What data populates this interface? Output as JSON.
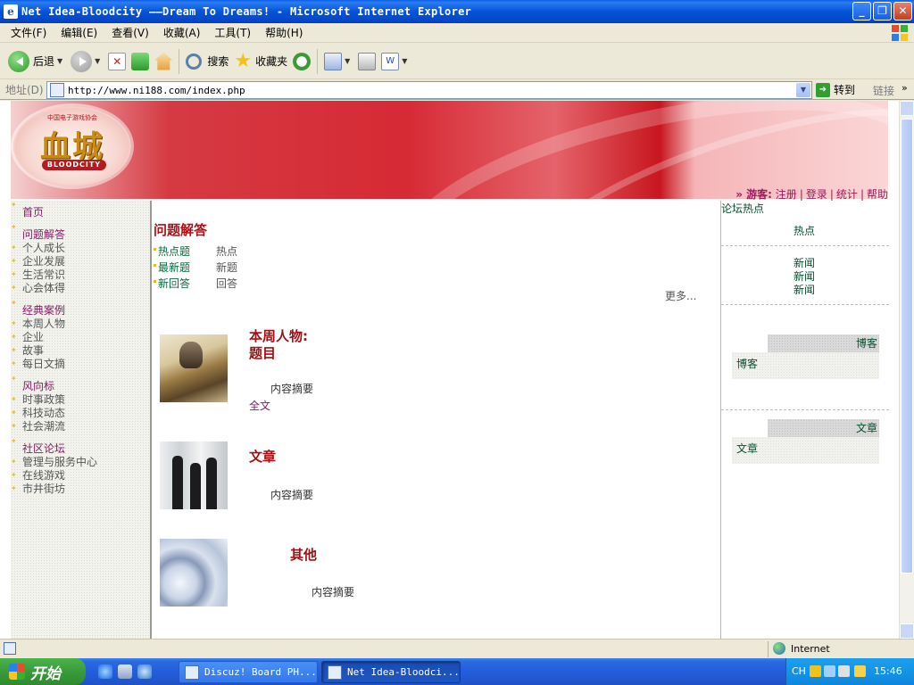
{
  "window": {
    "title": "Net Idea-Bloodcity ——Dream To Dreams! - Microsoft Internet Explorer",
    "controls": [
      "minimize-icon",
      "restore-icon",
      "close-icon"
    ]
  },
  "menubar": {
    "items": [
      "文件(F)",
      "编辑(E)",
      "查看(V)",
      "收藏(A)",
      "工具(T)",
      "帮助(H)"
    ]
  },
  "toolbar": {
    "back_label": "后退",
    "search_label": "搜索",
    "favorites_label": "收藏夹"
  },
  "address": {
    "label": "地址(D)",
    "url": "http://www.ni188.com/index.php",
    "go_label": "转到",
    "links_label": "链接"
  },
  "page": {
    "logo": {
      "org_text": "中国电子游戏协会",
      "cn_text": "血城",
      "en_text": "BLOODCITY"
    },
    "usernav": {
      "guest_label": "» 游客:",
      "links": [
        "注册",
        "登录",
        "统计",
        "帮助"
      ]
    },
    "left_nav": [
      {
        "heading": "首页",
        "items": []
      },
      {
        "heading": "问题解答",
        "items": [
          "个人成长",
          "企业发展",
          "生活常识",
          "心会体得"
        ]
      },
      {
        "heading": "经典案例",
        "items": [
          "本周人物",
          "企业",
          "故事",
          "每日文摘"
        ]
      },
      {
        "heading": "风向标",
        "items": [
          "时事政策",
          "科技动态",
          "社会潮流"
        ]
      },
      {
        "heading": "社区论坛",
        "items": [
          "管理与服务中心",
          "在线游戏",
          "市井街坊"
        ]
      }
    ],
    "qa": {
      "title": "问题解答",
      "rows": [
        {
          "label": "热点题",
          "value": "热点"
        },
        {
          "label": "最新题",
          "value": "新题"
        },
        {
          "label": "新回答",
          "value": "回答"
        }
      ],
      "more_label": "更多..."
    },
    "features": [
      {
        "title_line1": "本周人物:",
        "title_line2": "题目",
        "summary": "内容摘要",
        "link": "全文",
        "image": "warrior-photo"
      },
      {
        "title_line1": "文章",
        "summary": "内容摘要",
        "image": "business-people-photo"
      },
      {
        "title_line1": "其他",
        "summary": "内容摘要",
        "image": "abstract-swirl-photo"
      }
    ],
    "right": {
      "title": "论坛热点",
      "hot_label": "热点",
      "news": [
        "新闻",
        "新闻",
        "新闻"
      ],
      "blog_box": {
        "header": "博客",
        "body": "博客"
      },
      "article_box": {
        "header": "文章",
        "body": "文章"
      }
    }
  },
  "statusbar": {
    "zone": "Internet"
  },
  "taskbar": {
    "start_label": "开始",
    "tasks": [
      {
        "label": "Discuz! Board PH...",
        "active": false
      },
      {
        "label": "Net Idea-Bloodci...",
        "active": true
      }
    ],
    "tray_lang": "CH",
    "clock": "15:46"
  },
  "colors": {
    "banner_red": "#d62a35",
    "heading_red": "#b00e14",
    "nav_purple": "#8a1a6a",
    "link_green": "#0a6a3c",
    "xp_blue": "#245ddb"
  }
}
